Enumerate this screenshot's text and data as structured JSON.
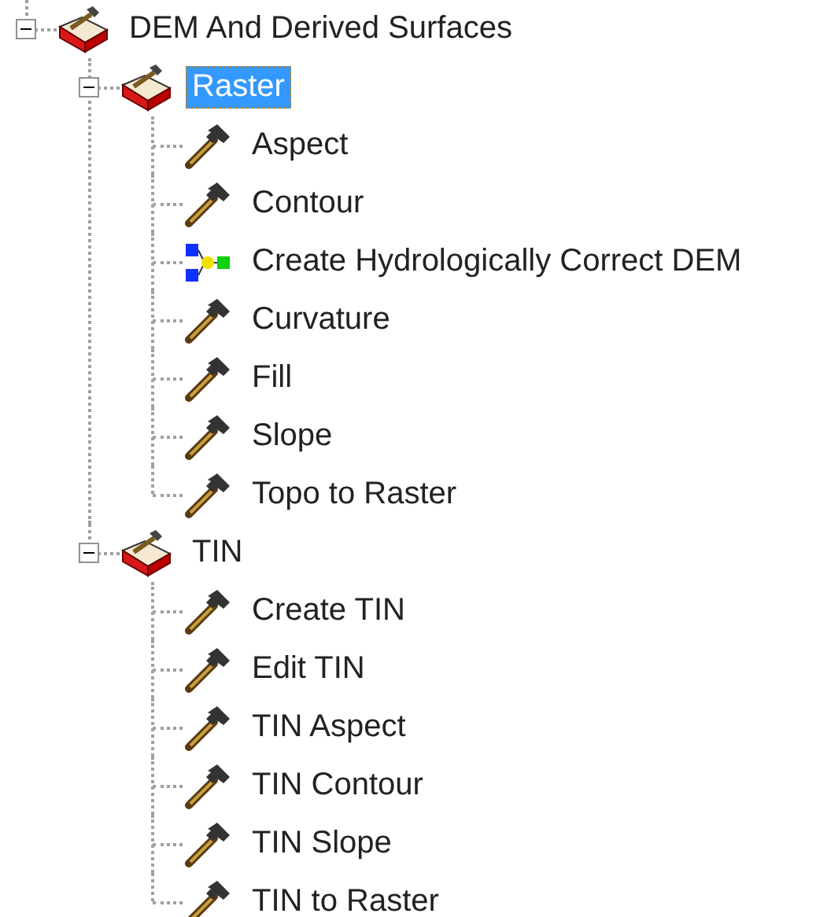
{
  "tree": [
    {
      "label": "DEM And Derived Surfaces",
      "kind": "toolbox",
      "expanded": true,
      "selected": false,
      "children": [
        {
          "label": "Raster",
          "kind": "toolbox",
          "expanded": true,
          "selected": true,
          "children": [
            {
              "label": "Aspect",
              "kind": "tool",
              "selected": false
            },
            {
              "label": "Contour",
              "kind": "tool",
              "selected": false
            },
            {
              "label": "Create Hydrologically Correct DEM",
              "kind": "model",
              "selected": false
            },
            {
              "label": "Curvature",
              "kind": "tool",
              "selected": false
            },
            {
              "label": "Fill",
              "kind": "tool",
              "selected": false
            },
            {
              "label": "Slope",
              "kind": "tool",
              "selected": false
            },
            {
              "label": "Topo to Raster",
              "kind": "tool",
              "selected": false
            }
          ]
        },
        {
          "label": "TIN",
          "kind": "toolbox",
          "expanded": true,
          "selected": false,
          "children": [
            {
              "label": "Create TIN",
              "kind": "tool",
              "selected": false
            },
            {
              "label": "Edit TIN",
              "kind": "tool",
              "selected": false
            },
            {
              "label": "TIN Aspect",
              "kind": "tool",
              "selected": false
            },
            {
              "label": "TIN Contour",
              "kind": "tool",
              "selected": false
            },
            {
              "label": "TIN Slope",
              "kind": "tool",
              "selected": false
            },
            {
              "label": "TIN to Raster",
              "kind": "tool",
              "selected": false
            }
          ]
        }
      ]
    }
  ]
}
